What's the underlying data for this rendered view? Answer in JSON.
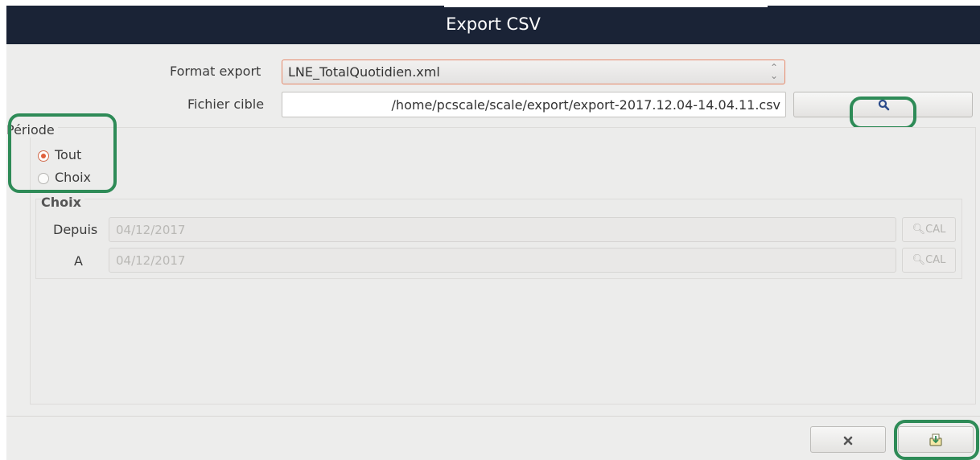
{
  "window": {
    "title": "Export CSV"
  },
  "form": {
    "format_label": "Format export",
    "format_value": "LNE_TotalQuotidien.xml",
    "fichier_label": "Fichier cible",
    "fichier_value": "/home/pcscale/scale/export/export-2017.12.04-14.04.11.csv"
  },
  "periode": {
    "label": "Période",
    "options": [
      {
        "label": "Tout",
        "checked": true
      },
      {
        "label": "Choix",
        "checked": false
      }
    ],
    "choix": {
      "title": "Choix",
      "depuis_label": "Depuis",
      "depuis_value": "04/12/2017",
      "a_label": "A",
      "a_value": "04/12/2017",
      "cal_label": "CAL"
    }
  },
  "icons": {
    "browse": "search-icon",
    "cancel": "close-icon",
    "export": "export-icon",
    "cal": "search-icon"
  },
  "colors": {
    "titlebar": "#1a2336",
    "highlight": "#2e8b57",
    "radio_accent": "#e0603c",
    "combo_border": "#e6896a"
  }
}
